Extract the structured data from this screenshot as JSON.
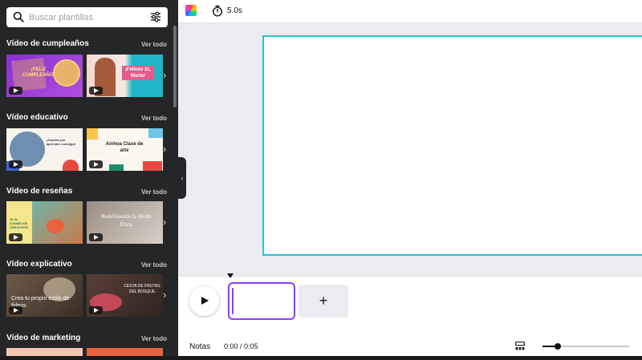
{
  "search": {
    "placeholder": "Buscar plantillas"
  },
  "sections": [
    {
      "title": "Vídeo de cumpleaños",
      "see_all": "Ver todo",
      "thumbs": [
        {
          "text": "¡FELIZ CUMPLEAÑOS!"
        },
        {
          "text": "¡Felices 21, Marta!"
        }
      ]
    },
    {
      "title": "Vídeo educativo",
      "see_all": "Ver todo",
      "thumbs": [
        {
          "text": "¡Gracias por aprender conmigo!"
        },
        {
          "text": "Ainhoa Clase de arte"
        }
      ]
    },
    {
      "title": "Vídeo de reseñas",
      "see_all": "Ver todo",
      "thumbs": [
        {
          "text": "10 de CONSEJOS CREATIVOS"
        },
        {
          "text": "Redefiniendo la Moda Ética"
        }
      ]
    },
    {
      "title": "Vídeo explicativo",
      "see_all": "Ver todo",
      "thumbs": [
        {
          "text": "Crea tu propio estilo de fideos"
        },
        {
          "text": "CESTA DE FRUTAS DEL BOSQUE"
        }
      ]
    },
    {
      "title": "Vídeo de marketing",
      "see_all": "Ver todo",
      "thumbs": []
    }
  ],
  "toolbar": {
    "duration": "5.0s"
  },
  "timeline": {
    "notes": "Notas",
    "time": "0:00 / 0:05",
    "add_symbol": "+",
    "zoom_level": 0.18
  },
  "colors": {
    "accent": "#8b3dff",
    "canvas_border": "#27c4d1",
    "sidebar_bg": "#252627"
  }
}
